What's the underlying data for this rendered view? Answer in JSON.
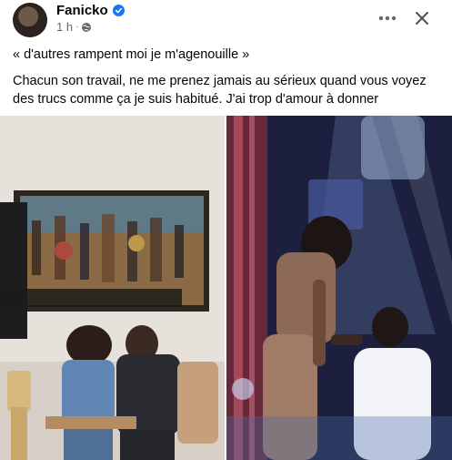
{
  "post": {
    "author": "Fanicko",
    "time": "1 h",
    "caption_line1": "« d'autres rampent moi je m'agenouille »",
    "caption_line2": "Chacun son travail, ne me prenez jamais au sérieux quand vous voyez des trucs comme ça je suis habitué. J'ai trop d'amour à donner"
  },
  "icons": {
    "verified": "verified-badge-icon",
    "audience": "globe-icon",
    "more": "more-horizontal-icon",
    "close": "close-icon"
  },
  "colors": {
    "verified": "#1877f2",
    "meta_text": "#65676b"
  }
}
